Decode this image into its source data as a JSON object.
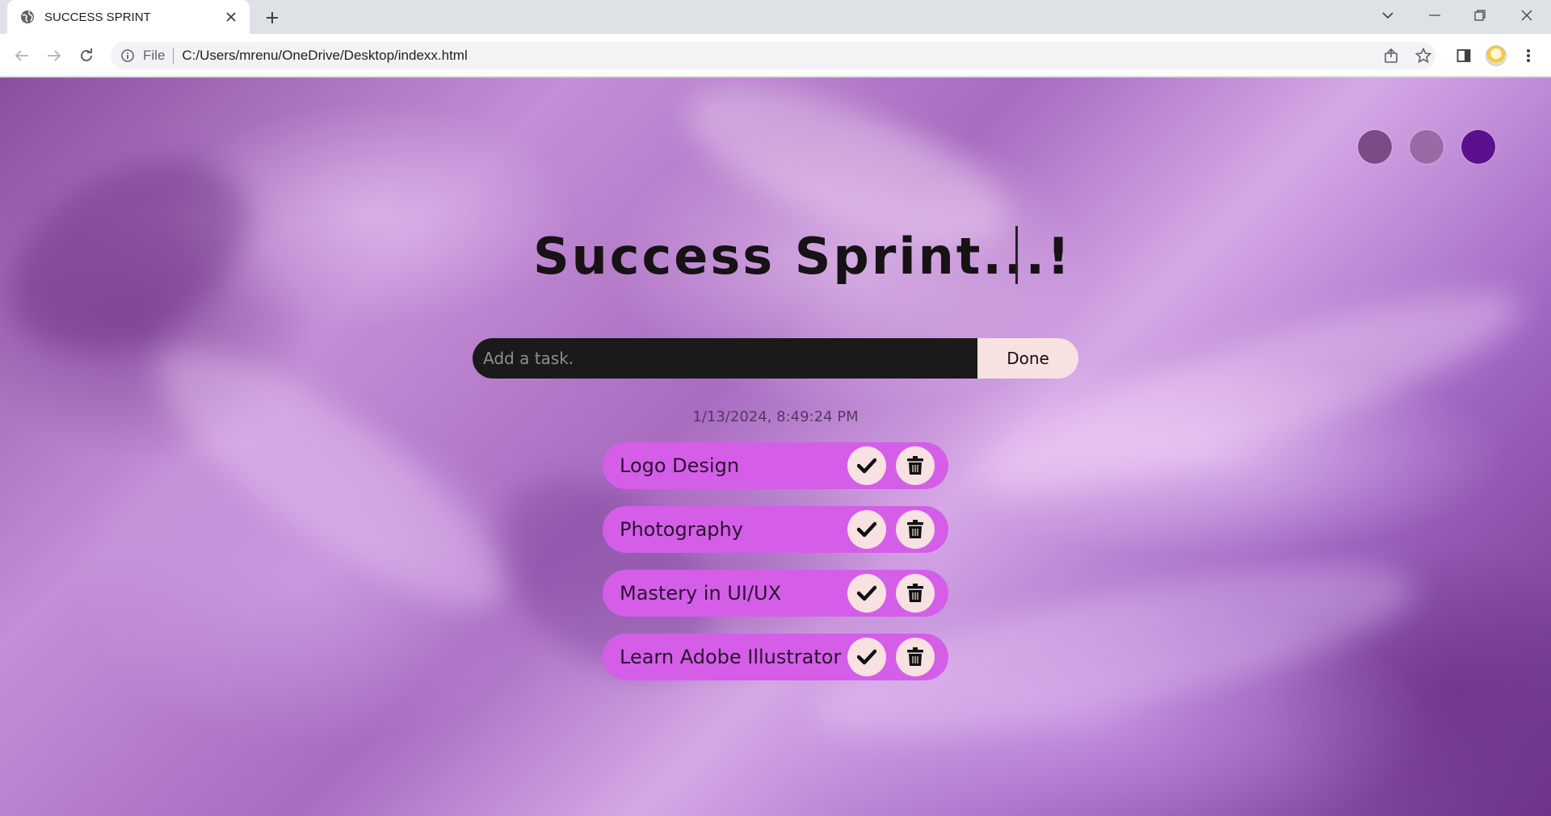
{
  "browser": {
    "tab_title": "SUCCESS SPRINT",
    "address_scheme": "File",
    "address_url": "C:/Users/mrenu/OneDrive/Desktop/indexx.html"
  },
  "page": {
    "heading": "Success Sprint...!",
    "input_placeholder": "Add a task.",
    "done_label": "Done",
    "datetime": "1/13/2024, 8:49:24 PM",
    "theme_colors": [
      "#7c4a86",
      "#9b6aa6",
      "#5a0f8c"
    ],
    "tasks": [
      {
        "text": "Logo Design"
      },
      {
        "text": "Photography"
      },
      {
        "text": "Mastery in UI/UX"
      },
      {
        "text": "Learn Adobe Illustrator"
      }
    ],
    "task_color": "#d45ee8",
    "button_color": "#f7e1e1"
  }
}
